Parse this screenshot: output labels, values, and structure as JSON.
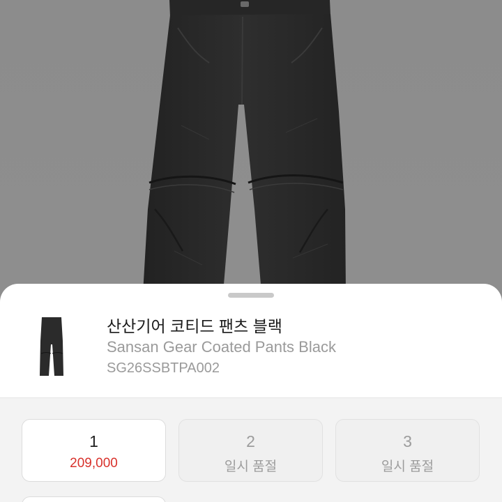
{
  "product": {
    "name_ko": "산산기어 코티드 팬츠 블랙",
    "name_en": "Sansan Gear Coated Pants Black",
    "sku": "SG26SSBTPA002"
  },
  "options": [
    {
      "size": "1",
      "price": "209,000",
      "status": "available"
    },
    {
      "size": "2",
      "status_text": "일시 품절",
      "status": "soldout"
    },
    {
      "size": "3",
      "status_text": "일시 품절",
      "status": "soldout"
    }
  ],
  "colors": {
    "price": "#d8312b",
    "soldout_text": "#9c9c9c",
    "photo_background": "#8e8e8e",
    "garment": "#2a2a2a"
  },
  "icons": {
    "grabber": "sheet-drag-handle",
    "thumbnail": "product-thumbnail-pants"
  }
}
